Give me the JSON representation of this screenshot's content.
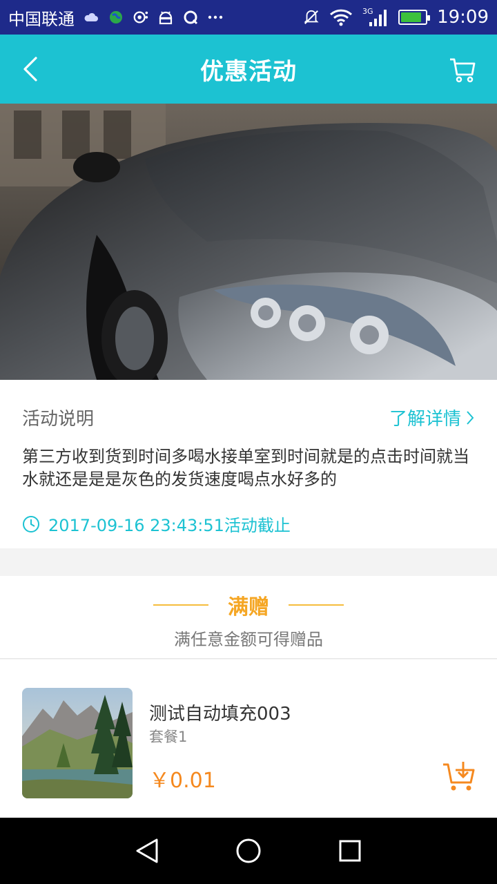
{
  "status_bar": {
    "carrier": "中国联通",
    "network": "3G",
    "time": "19:09",
    "battery_level": 0.85,
    "icons": [
      "cloud-icon",
      "globe-icon",
      "radar-icon",
      "android-icon",
      "qq-icon",
      "more-icon",
      "mute-icon",
      "wifi-icon",
      "signal-icon",
      "battery-icon"
    ]
  },
  "nav": {
    "title": "优惠活动",
    "back_icon": "back-arrow-icon",
    "cart_icon": "cart-icon"
  },
  "banner": {
    "image": "black-sports-car-photo"
  },
  "activity": {
    "title": "活动说明",
    "more_label": "了解详情",
    "description": "第三方收到货到时间多喝水接单室到时间就是的点击时间就当水就还是是是灰色的发货速度喝点水好多的",
    "end_time": "2017-09-16 23:43:51活动截止"
  },
  "gift": {
    "title": "满赠",
    "subtitle": "满任意金额可得赠品"
  },
  "product": {
    "name": "测试自动填充003",
    "spec": "套餐1",
    "price": "￥0.01",
    "thumbnail": "mountain-landscape-painting"
  },
  "system_nav": {
    "icons": [
      "back-triangle-icon",
      "home-circle-icon",
      "recents-square-icon"
    ]
  },
  "colors": {
    "accent": "#1cc2d2",
    "status_bar": "#1e2a8a",
    "gift_title": "#f5a623",
    "price": "#f5891f"
  }
}
